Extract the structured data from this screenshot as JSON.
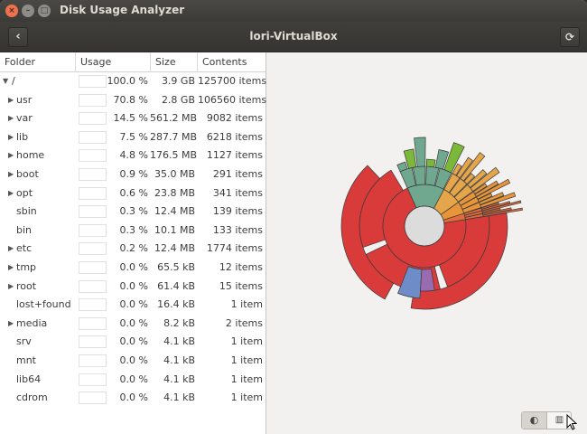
{
  "window": {
    "title": "Disk Usage Analyzer"
  },
  "header": {
    "title": "lori-VirtualBox"
  },
  "table": {
    "columns": [
      "Folder",
      "Usage",
      "Size",
      "Contents"
    ],
    "rows": [
      {
        "name": "/",
        "usage": "100.0 %",
        "size": "3.9 GB",
        "contents": "125700 items",
        "expander": "expanded",
        "indent": 0
      },
      {
        "name": "usr",
        "usage": "70.8 %",
        "size": "2.8 GB",
        "contents": "106560 items",
        "expander": "collapsed",
        "indent": 1
      },
      {
        "name": "var",
        "usage": "14.5 %",
        "size": "561.2 MB",
        "contents": "9082 items",
        "expander": "collapsed",
        "indent": 1
      },
      {
        "name": "lib",
        "usage": "7.5 %",
        "size": "287.7 MB",
        "contents": "6218 items",
        "expander": "collapsed",
        "indent": 1
      },
      {
        "name": "home",
        "usage": "4.8 %",
        "size": "176.5 MB",
        "contents": "1127 items",
        "expander": "collapsed",
        "indent": 1
      },
      {
        "name": "boot",
        "usage": "0.9 %",
        "size": "35.0 MB",
        "contents": "291 items",
        "expander": "collapsed",
        "indent": 1
      },
      {
        "name": "opt",
        "usage": "0.6 %",
        "size": "23.8 MB",
        "contents": "341 items",
        "expander": "collapsed",
        "indent": 1
      },
      {
        "name": "sbin",
        "usage": "0.3 %",
        "size": "12.4 MB",
        "contents": "139 items",
        "expander": "none",
        "indent": 1
      },
      {
        "name": "bin",
        "usage": "0.3 %",
        "size": "10.1 MB",
        "contents": "133 items",
        "expander": "none",
        "indent": 1
      },
      {
        "name": "etc",
        "usage": "0.2 %",
        "size": "12.4 MB",
        "contents": "1774 items",
        "expander": "collapsed",
        "indent": 1
      },
      {
        "name": "tmp",
        "usage": "0.0 %",
        "size": "65.5 kB",
        "contents": "12 items",
        "expander": "collapsed",
        "indent": 1
      },
      {
        "name": "root",
        "usage": "0.0 %",
        "size": "61.4 kB",
        "contents": "15 items",
        "expander": "collapsed",
        "indent": 1
      },
      {
        "name": "lost+found",
        "usage": "0.0 %",
        "size": "16.4 kB",
        "contents": "1 item",
        "expander": "none",
        "indent": 1
      },
      {
        "name": "media",
        "usage": "0.0 %",
        "size": "8.2 kB",
        "contents": "2 items",
        "expander": "collapsed",
        "indent": 1
      },
      {
        "name": "srv",
        "usage": "0.0 %",
        "size": "4.1 kB",
        "contents": "1 item",
        "expander": "none",
        "indent": 1
      },
      {
        "name": "mnt",
        "usage": "0.0 %",
        "size": "4.1 kB",
        "contents": "1 item",
        "expander": "none",
        "indent": 1
      },
      {
        "name": "lib64",
        "usage": "0.0 %",
        "size": "4.1 kB",
        "contents": "1 item",
        "expander": "none",
        "indent": 1
      },
      {
        "name": "cdrom",
        "usage": "0.0 %",
        "size": "4.1 kB",
        "contents": "1 item",
        "expander": "none",
        "indent": 1
      }
    ]
  },
  "chart": {
    "type": "rings",
    "segments": [
      {
        "folder": "usr",
        "fraction": 0.708,
        "color": "#d93a3a"
      },
      {
        "folder": "var",
        "fraction": 0.145,
        "color": "#6fa88f"
      },
      {
        "folder": "lib",
        "fraction": 0.075,
        "color": "#e5a54a"
      },
      {
        "folder": "home",
        "fraction": 0.048,
        "color": "#e8953a"
      },
      {
        "folder": "other",
        "fraction": 0.024,
        "color": "#e36a3a"
      }
    ],
    "accent_colors": [
      "#7ab83a",
      "#6e8cc8",
      "#9a6bb0",
      "#e8c24a"
    ]
  },
  "view_toggle": {
    "rings_icon": "rings-chart-icon",
    "treemap_icon": "treemap-chart-icon"
  },
  "icons": {
    "back": "back-arrow-icon",
    "refresh": "refresh-icon",
    "close": "close-icon",
    "minimize": "minimize-icon",
    "maximize": "maximize-icon"
  }
}
